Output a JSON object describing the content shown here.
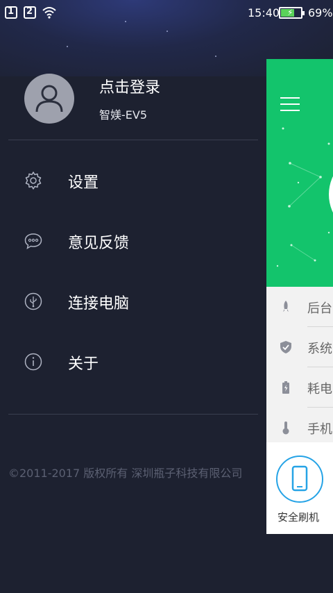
{
  "status_bar": {
    "sim1": "1",
    "sim2": "2",
    "time": "15:40",
    "battery_percent": "69%",
    "battery_level": 0.69
  },
  "profile": {
    "login_label": "点击登录",
    "device_name": "智媄-EV5"
  },
  "menu": {
    "items": [
      {
        "label": "设置",
        "icon": "gear-icon"
      },
      {
        "label": "意见反馈",
        "icon": "feedback-icon"
      },
      {
        "label": "连接电脑",
        "icon": "usb-icon"
      },
      {
        "label": "关于",
        "icon": "info-icon"
      }
    ]
  },
  "copyright": "©2011-2017 版权所有 深圳瓶子科技有限公司",
  "background_app": {
    "accent_color": "#13c46c",
    "list": [
      {
        "text": "后台",
        "icon": "rocket-icon"
      },
      {
        "text": "系统",
        "icon": "shield-icon"
      },
      {
        "text": "耗电",
        "icon": "battery-icon"
      },
      {
        "text": "手机",
        "icon": "thermometer-icon"
      }
    ],
    "flash_label": "安全刷机"
  }
}
